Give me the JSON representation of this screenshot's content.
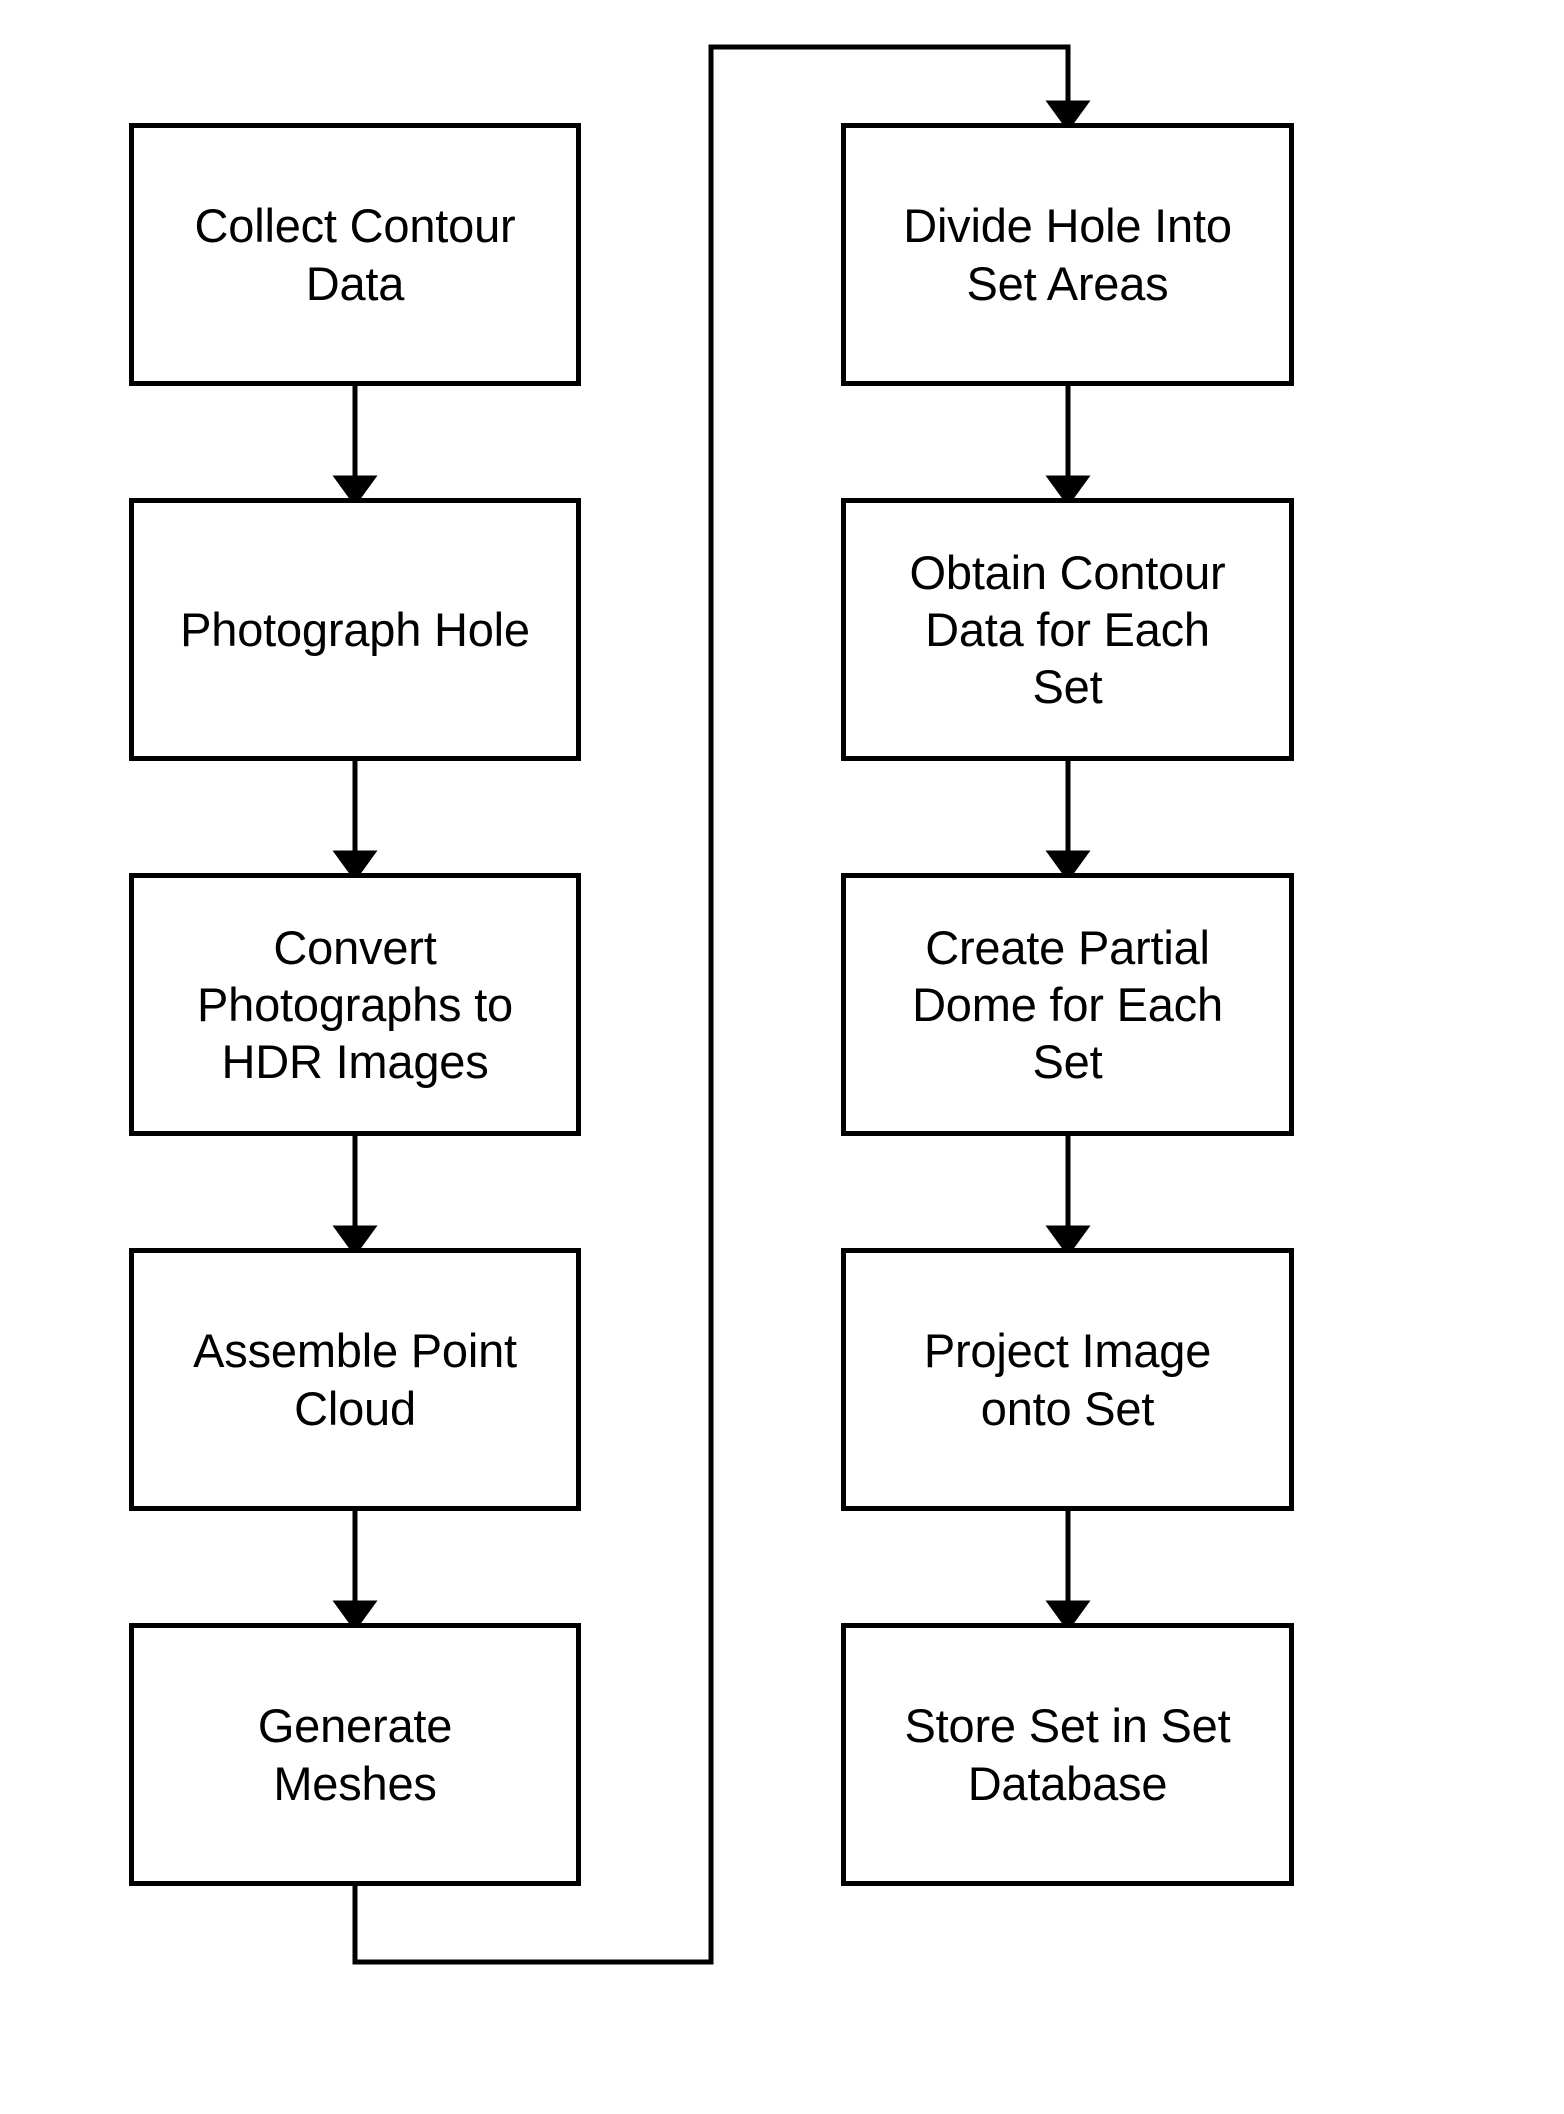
{
  "diagram": {
    "type": "flowchart",
    "orientation": "two-column-vertical",
    "background_color": "#ffffff",
    "stroke_color": "#000000",
    "text_color": "#000000",
    "columns": [
      {
        "id": "left-column",
        "name": "capture-and-reconstruction",
        "nodes": [
          {
            "id": "collect-contour-data",
            "label": "Collect Contour\nData"
          },
          {
            "id": "photograph-hole",
            "label": "Photograph Hole"
          },
          {
            "id": "convert-photographs-to-hdr-images",
            "label": "Convert\nPhotographs to\nHDR Images"
          },
          {
            "id": "assemble-point-cloud",
            "label": "Assemble Point\nCloud"
          },
          {
            "id": "generate-meshes",
            "label": "Generate\nMeshes"
          }
        ]
      },
      {
        "id": "right-column",
        "name": "set-construction-and-storage",
        "nodes": [
          {
            "id": "divide-hole-into-set-areas",
            "label": "Divide Hole Into\nSet Areas"
          },
          {
            "id": "obtain-contour-data-for-each-set",
            "label": "Obtain Contour\nData for Each\nSet"
          },
          {
            "id": "create-partial-dome-for-each-set",
            "label": "Create Partial\nDome for Each\nSet"
          },
          {
            "id": "project-image-onto-set",
            "label": "Project Image\nonto Set"
          },
          {
            "id": "store-set-in-set-database",
            "label": "Store Set in Set\nDatabase"
          }
        ]
      }
    ],
    "connectors": [
      {
        "id": "conn-1",
        "from": "collect-contour-data",
        "to": "photograph-hole",
        "style": "straight-down-arrow"
      },
      {
        "id": "conn-2",
        "from": "photograph-hole",
        "to": "convert-photographs-to-hdr-images",
        "style": "straight-down-arrow"
      },
      {
        "id": "conn-3",
        "from": "convert-photographs-to-hdr-images",
        "to": "assemble-point-cloud",
        "style": "straight-down-arrow"
      },
      {
        "id": "conn-4",
        "from": "assemble-point-cloud",
        "to": "generate-meshes",
        "style": "straight-down-arrow"
      },
      {
        "id": "conn-5",
        "from": "generate-meshes",
        "to": "divide-hole-into-set-areas",
        "style": "routed-loop-arrow"
      },
      {
        "id": "conn-6",
        "from": "divide-hole-into-set-areas",
        "to": "obtain-contour-data-for-each-set",
        "style": "straight-down-arrow"
      },
      {
        "id": "conn-7",
        "from": "obtain-contour-data-for-each-set",
        "to": "create-partial-dome-for-each-set",
        "style": "straight-down-arrow"
      },
      {
        "id": "conn-8",
        "from": "create-partial-dome-for-each-set",
        "to": "project-image-onto-set",
        "style": "straight-down-arrow"
      },
      {
        "id": "conn-9",
        "from": "project-image-onto-set",
        "to": "store-set-in-set-database",
        "style": "straight-down-arrow"
      }
    ]
  }
}
